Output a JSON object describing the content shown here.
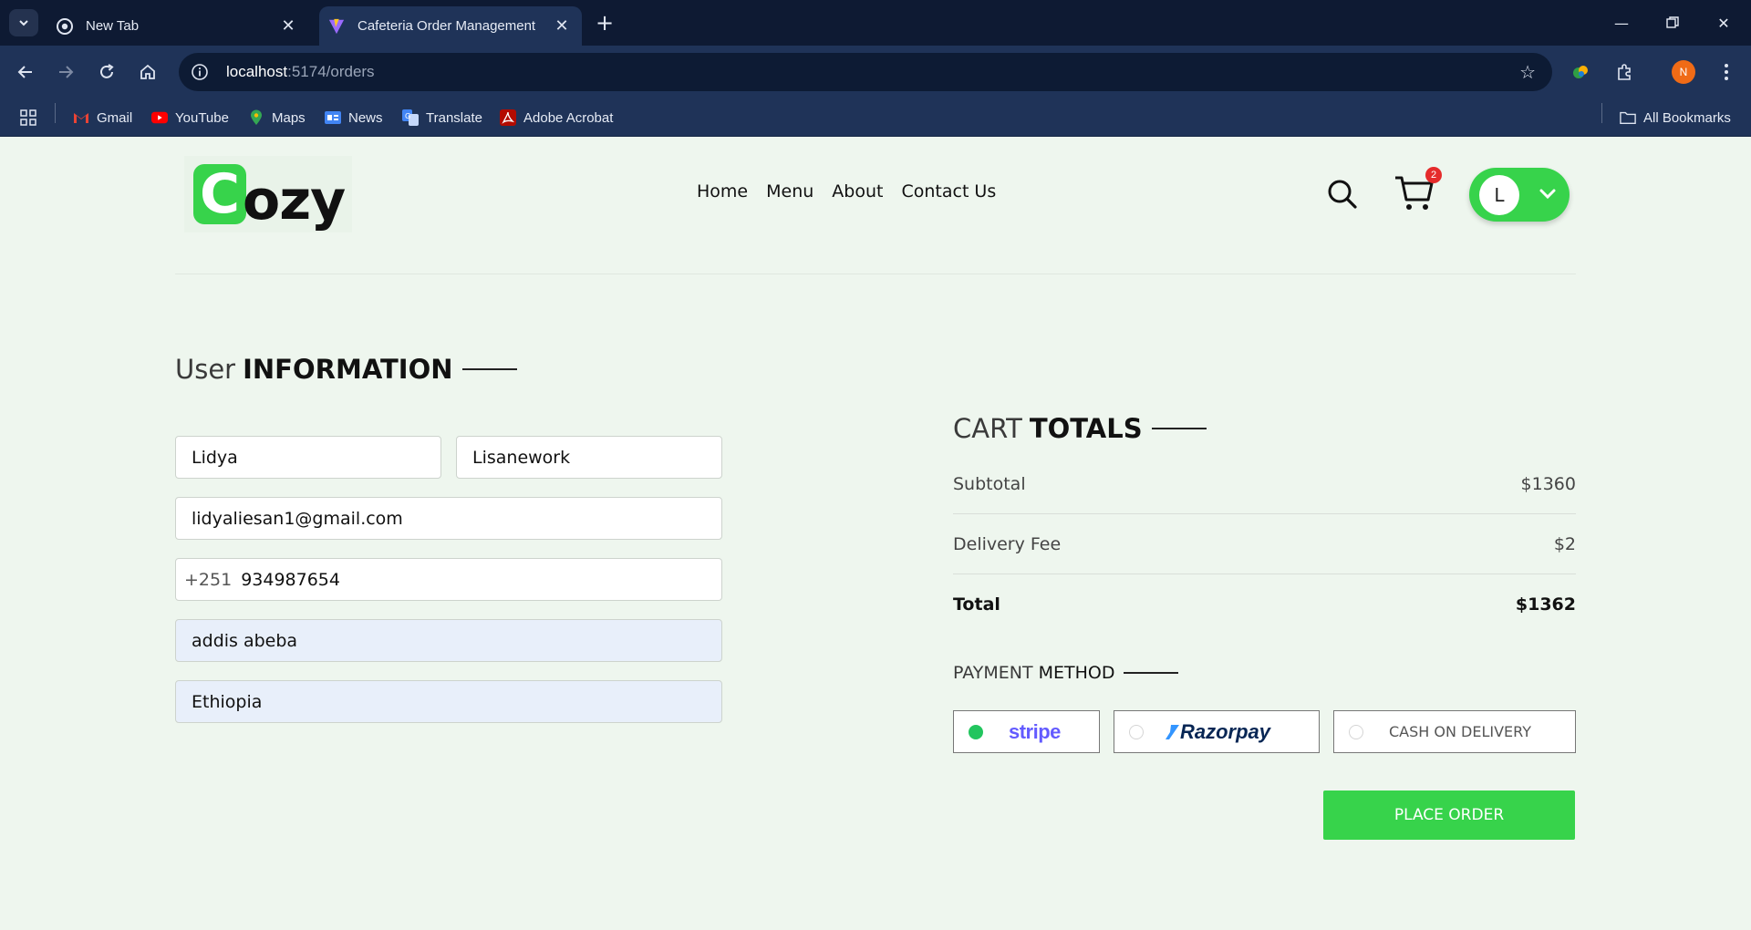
{
  "browser": {
    "tabs": [
      {
        "title": "New Tab",
        "active": false
      },
      {
        "title": "Cafeteria Order Management",
        "active": true
      }
    ],
    "url_host": "localhost",
    "url_rest": ":5174/orders",
    "bookmarks": [
      "Gmail",
      "YouTube",
      "Maps",
      "News",
      "Translate",
      "Adobe Acrobat"
    ],
    "all_bookmarks": "All Bookmarks",
    "profile_initial": "N"
  },
  "site": {
    "logo_first": "C",
    "logo_rest": "ozy",
    "nav": [
      "Home",
      "Menu",
      "About",
      "Contact Us"
    ],
    "cart_count": "2",
    "user_initial": "L",
    "accent": "#37d34b"
  },
  "user_info": {
    "title_light": "User",
    "title_bold": "INFORMATION",
    "first_name": "Lidya",
    "last_name": "Lisanework",
    "email": "lidyaliesan1@gmail.com",
    "phone_code": "+251",
    "phone": "934987654",
    "city": "addis abeba",
    "country": "Ethiopia"
  },
  "cart_totals": {
    "title_light": "CART",
    "title_bold": "TOTALS",
    "subtotal_label": "Subtotal",
    "subtotal": "$1360",
    "delivery_label": "Delivery Fee",
    "delivery": "$2",
    "total_label": "Total",
    "total": "$1362"
  },
  "payment": {
    "title_light": "PAYMENT",
    "title_bold": "METHOD",
    "options": [
      "stripe",
      "Razorpay",
      "CASH ON DELIVERY"
    ],
    "selected": "stripe"
  },
  "place_order_label": "PLACE ORDER"
}
